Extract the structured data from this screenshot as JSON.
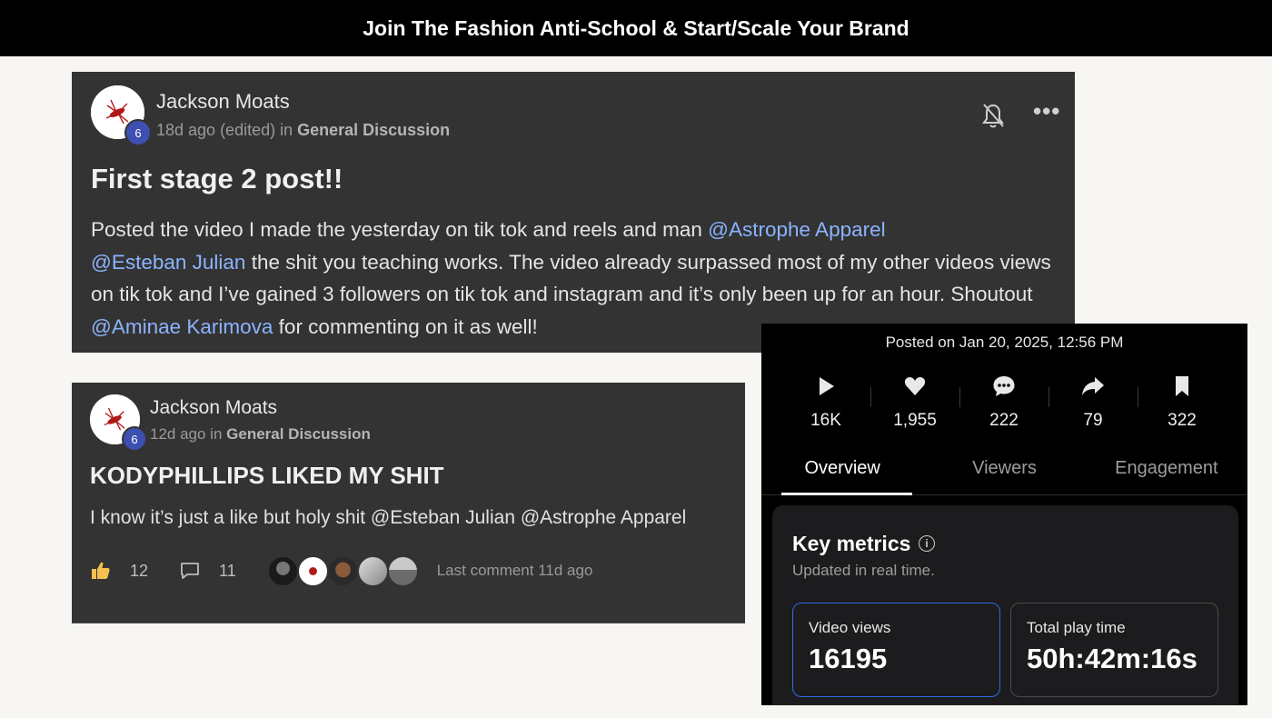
{
  "banner": {
    "text": "Join The Fashion Anti-School & Start/Scale Your Brand"
  },
  "post1": {
    "author": "Jackson Moats",
    "level": "6",
    "time": "18d ago (edited) in ",
    "category": "General Discussion",
    "title": "First stage 2 post!!",
    "body": {
      "t1": "Posted the video I made the yesterday on tik tok and reels and man ",
      "m1": "@Astrophe Apparel",
      "t2": " ",
      "m2": "@Esteban Julian",
      "t3": " the shit you teaching works. The video already surpassed most of my other videos views on tik tok and I’ve gained 3 followers on tik tok and instagram and it’s only been up for an hour. Shoutout ",
      "m3": "@Aminae Karimova",
      "t4": " for commenting on it as well!"
    },
    "icons": {
      "bell": "bell-off-icon",
      "more": "more-dots-icon"
    }
  },
  "post2": {
    "author": "Jackson Moats",
    "level": "6",
    "time": "12d ago in ",
    "category": "General Discussion",
    "title": "KODYPHILLIPS LIKED MY SHIT",
    "body": "I know it’s just a like but holy shit @Esteban Julian @Astrophe Apparel",
    "likes": "12",
    "comments": "11",
    "last_comment": "Last comment 11d ago",
    "icons": {
      "like": "thumbs-up-icon",
      "comment": "comment-icon"
    }
  },
  "analytics": {
    "posted": "Posted on Jan 20, 2025, 12:56 PM",
    "stats": [
      {
        "icon": "play-icon",
        "value": "16K"
      },
      {
        "icon": "heart-icon",
        "value": "1,955"
      },
      {
        "icon": "comment-bubble-icon",
        "value": "222"
      },
      {
        "icon": "share-icon",
        "value": "79"
      },
      {
        "icon": "bookmark-icon",
        "value": "322"
      }
    ],
    "tabs": [
      "Overview",
      "Viewers",
      "Engagement"
    ],
    "active_tab": "Overview",
    "key_metrics": {
      "title": "Key metrics",
      "subtitle": "Updated in real time.",
      "metrics": [
        {
          "label": "Video views",
          "value": "16195"
        },
        {
          "label": "Total play time",
          "value": "50h:42m:16s"
        }
      ]
    }
  },
  "colors": {
    "post_bg": "#333333",
    "mention": "#8bb3ff",
    "level_badge": "#3d4fb0",
    "selected_border": "#2b6de0"
  }
}
